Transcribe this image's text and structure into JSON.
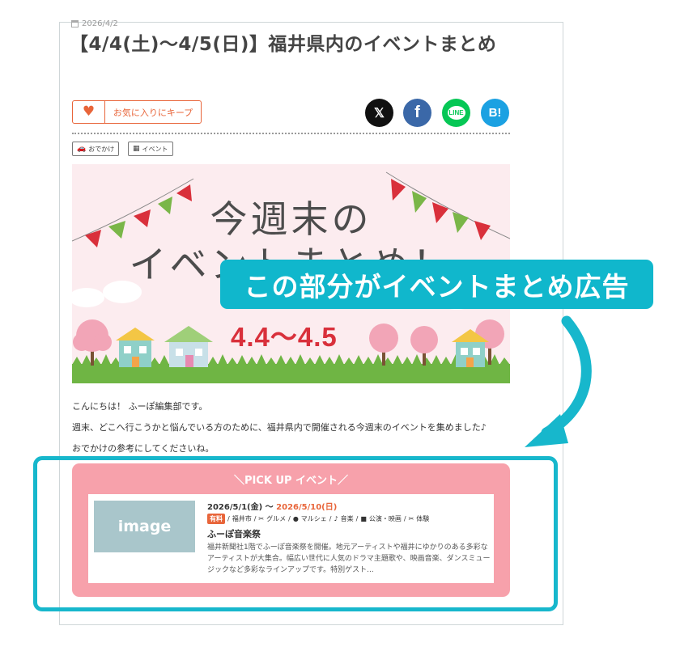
{
  "article": {
    "date": "2026/4/2",
    "title": "【4/4(土)〜4/5(日)】福井県内のイベントまとめ",
    "keep_label": "お気に入りにキープ",
    "tags": [
      "おでかけ",
      "イベント"
    ]
  },
  "share": {
    "x": "𝕏",
    "facebook": "f",
    "line": "LINE",
    "hatena": "B!"
  },
  "hero": {
    "line1": "今週末の",
    "line2": "イベントまとめ！",
    "dates": "4.4～4.5"
  },
  "callout": "この部分がイベントまとめ広告",
  "body": {
    "p1": "こんにちは！ ふーぽ編集部です。",
    "p2": "週末、どこへ行こうかと悩んでいる方のために、福井県内で開催される今週末のイベントを集めました♪",
    "p3": "おでかけの参考にしてくださいね。"
  },
  "pickup": {
    "title": "＼PICK UP イベント／",
    "image_label": "image",
    "date_start": "2026/5/1(金) ～ ",
    "date_end": "2026/5/10(日)",
    "paid": "有料",
    "categories": [
      "福井市",
      "グルメ",
      "マルシェ",
      "音楽",
      "公演・映画",
      "体験"
    ],
    "name": "ふーぽ音楽祭",
    "description": "福井新聞社1階でふーぽ音楽祭を開催。地元アーティストや福井にゆかりのある多彩なアーティストが大集合。幅広い世代に人気のドラマ主題歌や、映画音楽、ダンスミュージックなど多彩なラインアップです。特別ゲスト..."
  },
  "colors": {
    "accent_orange": "#e8653a",
    "callout_teal": "#10b7cc",
    "pickup_pink": "#f7a1ab",
    "hero_bg": "#fcecef"
  }
}
